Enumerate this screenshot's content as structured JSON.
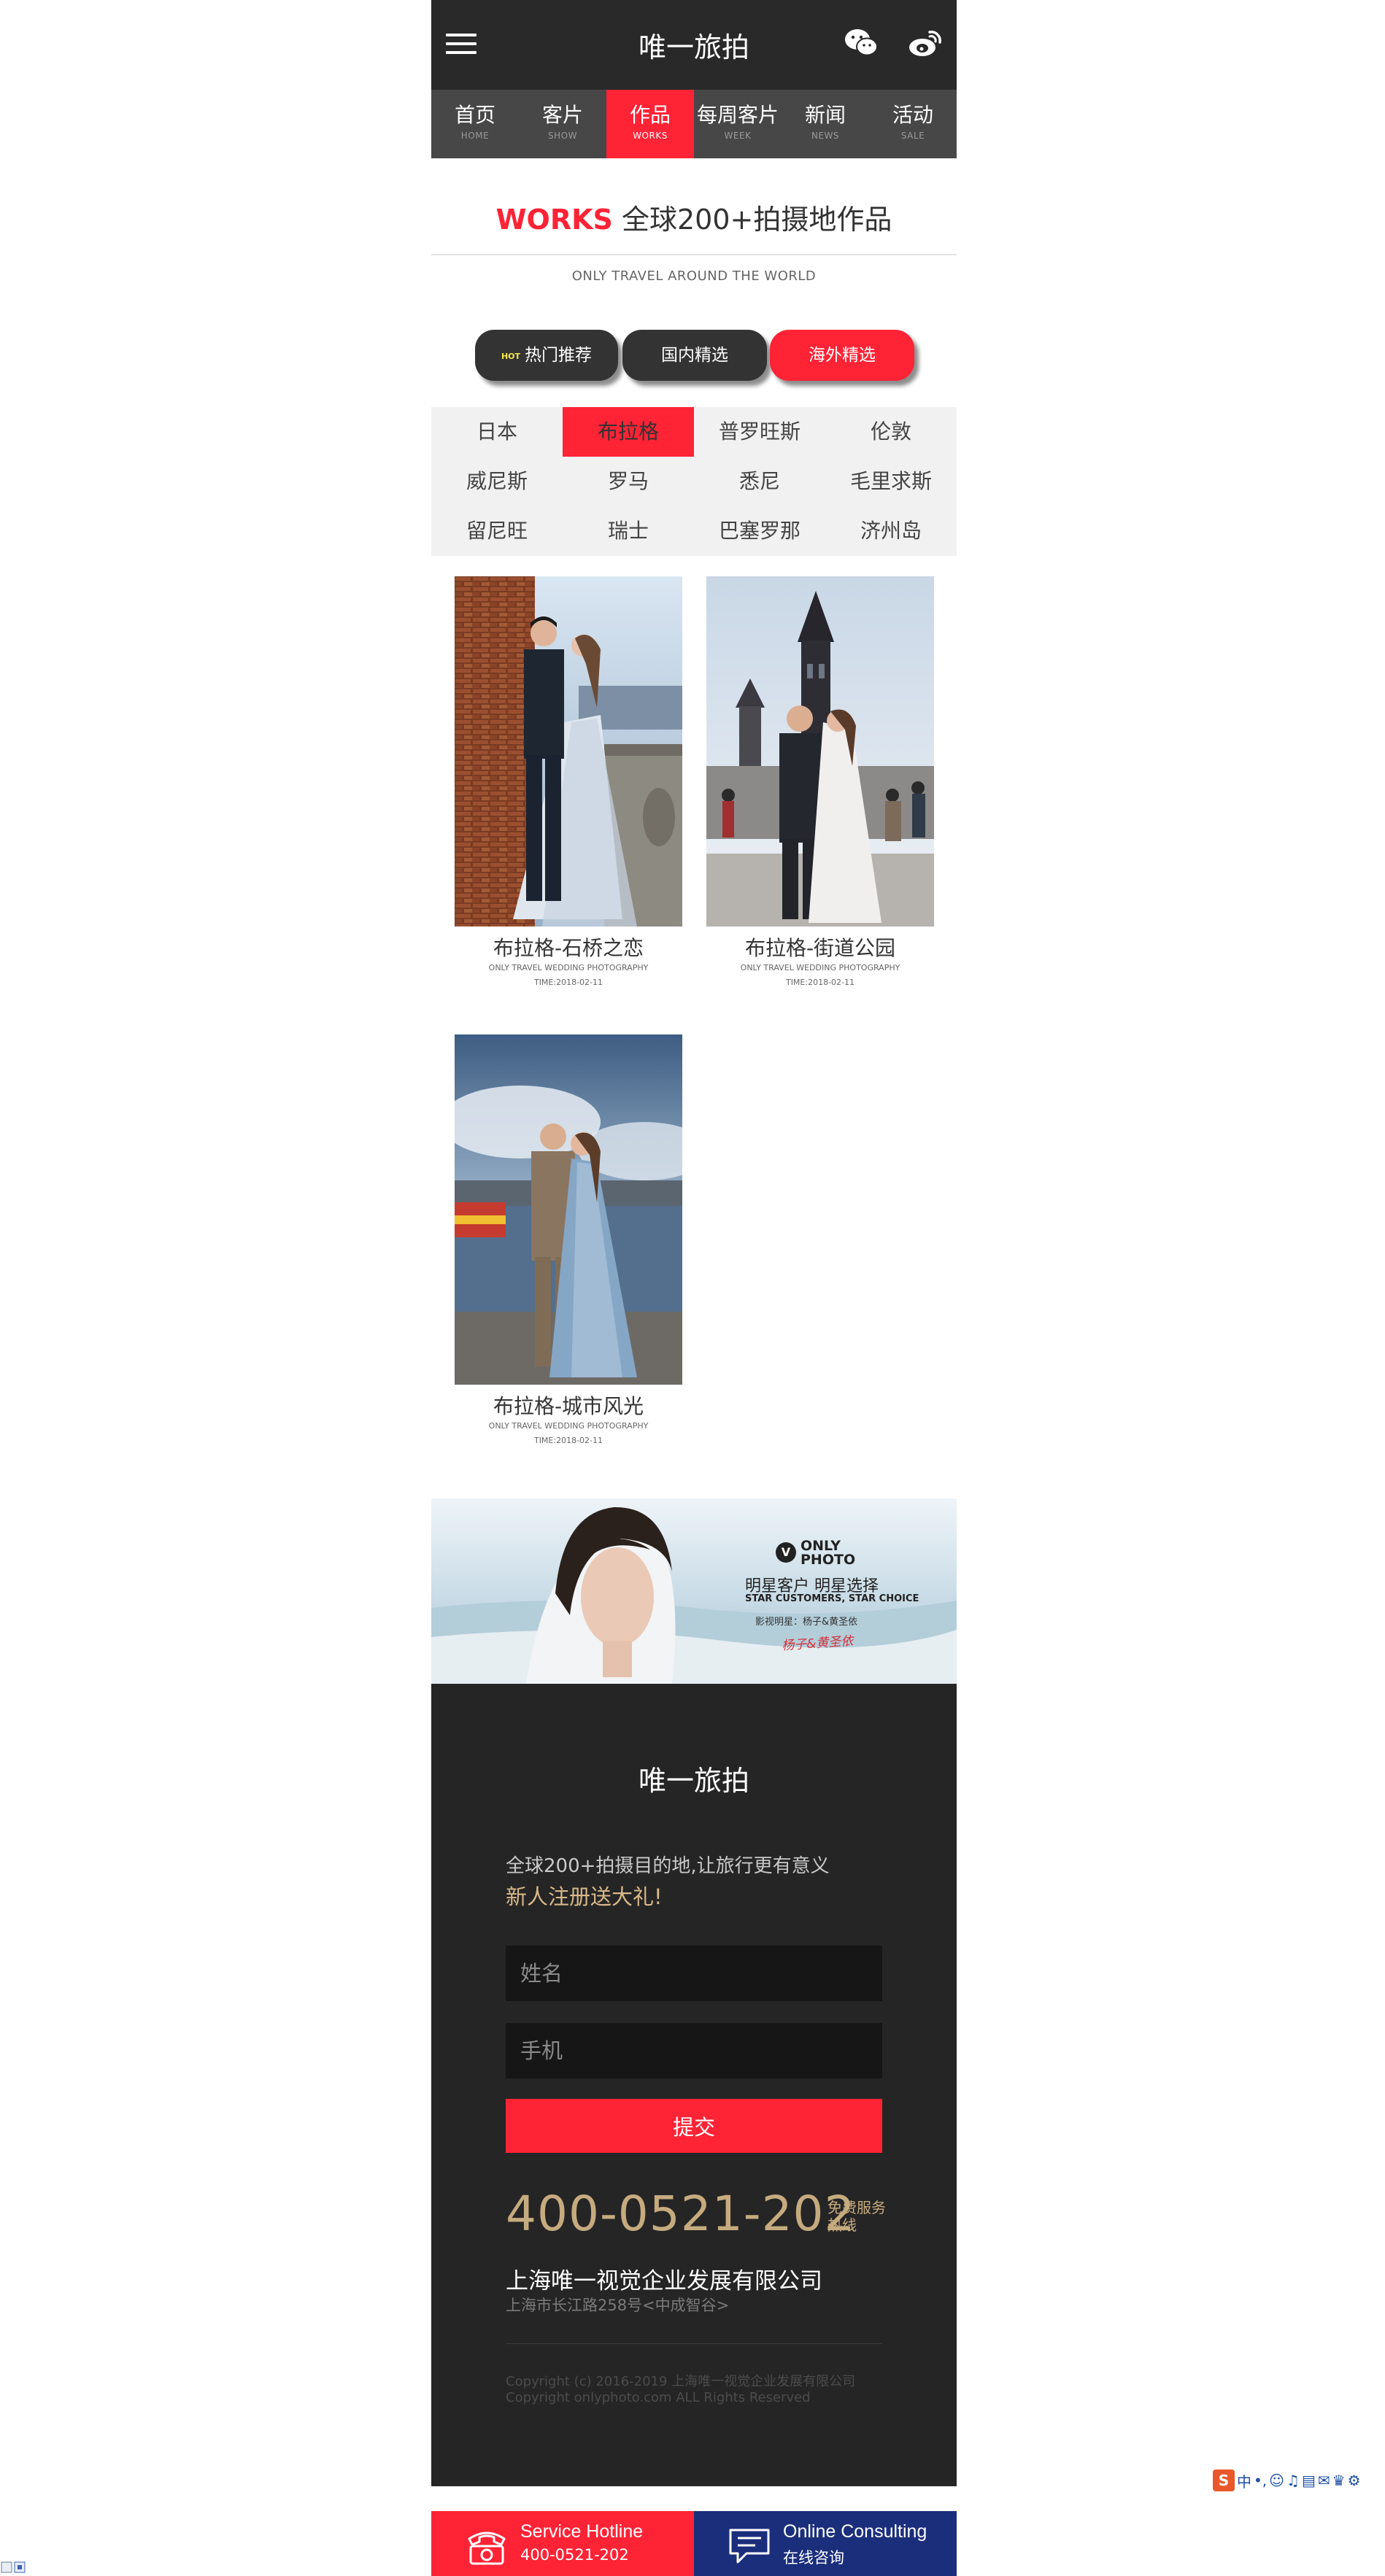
{
  "header": {
    "title": "唯一旅拍"
  },
  "nav": [
    {
      "zh": "首页",
      "en": "HOME"
    },
    {
      "zh": "客片",
      "en": "SHOW"
    },
    {
      "zh": "作品",
      "en": "WORKS"
    },
    {
      "zh": "每周客片",
      "en": "WEEK"
    },
    {
      "zh": "新闻",
      "en": "NEWS"
    },
    {
      "zh": "活动",
      "en": "SALE"
    }
  ],
  "section": {
    "works_word": "WORKS",
    "title_rest": " 全球200+拍摄地作品",
    "subtitle": "ONLY TRAVEL AROUND THE WORLD"
  },
  "filters": {
    "hot_badge": "HOT",
    "hot": "热门推荐",
    "domestic": "国内精选",
    "overseas": "海外精选"
  },
  "cities": [
    "日本",
    "布拉格",
    "普罗旺斯",
    "伦敦",
    "威尼斯",
    "罗马",
    "悉尼",
    "毛里求斯",
    "留尼旺",
    "瑞士",
    "巴塞罗那",
    "济州岛"
  ],
  "works": [
    {
      "title": "布拉格-石桥之恋",
      "sub": "ONLY TRAVEL WEDDING PHOTOGRAPHY",
      "time": "TIME:2018-02-11"
    },
    {
      "title": "布拉格-街道公园",
      "sub": "ONLY TRAVEL WEDDING PHOTOGRAPHY",
      "time": "TIME:2018-02-11"
    },
    {
      "title": "布拉格-城市风光",
      "sub": "ONLY TRAVEL WEDDING PHOTOGRAPHY",
      "time": "TIME:2018-02-11"
    }
  ],
  "banner": {
    "logo_mark": "V",
    "logo_text": "ONLY PHOTO",
    "headline": "明星客户 明星选择",
    "headline_en": "STAR CUSTOMERS, STAR CHOICE",
    "caption": "影视明星：杨子&黄圣依",
    "signature": "杨子&黄圣依"
  },
  "footer": {
    "title": "唯一旅拍",
    "line1": "全球200+拍摄目的地,让旅行更有意义",
    "line2": "新人注册送大礼!",
    "name_placeholder": "姓名",
    "phone_placeholder": "手机",
    "submit": "提交",
    "hotline": "400-0521-202",
    "hotline_label": "免费服务热线",
    "company": "上海唯一视觉企业发展有限公司",
    "address": "上海市长江路258号<中成智谷>",
    "copyright1": "Copyright (c) 2016-2019 上海唯一视觉企业发展有限公司",
    "copyright2": "Copyright onlyphoto.com ALL Rights Reserved"
  },
  "bottom_bar": {
    "hotline_en": "Service Hotline",
    "hotline_num": "400-0521-202",
    "consult_en": "Online Consulting",
    "consult_zh": "在线咨询"
  },
  "ime": {
    "logo": "S",
    "mode": "中"
  },
  "colors": {
    "accent": "#ff2336",
    "dark": "#292929",
    "nav": "#474747",
    "gold": "#c6ab7f",
    "consult_blue": "#1b2e7c"
  },
  "icons": [
    "menu-icon",
    "wechat-icon",
    "weibo-icon",
    "phone-icon",
    "chat-icon"
  ]
}
